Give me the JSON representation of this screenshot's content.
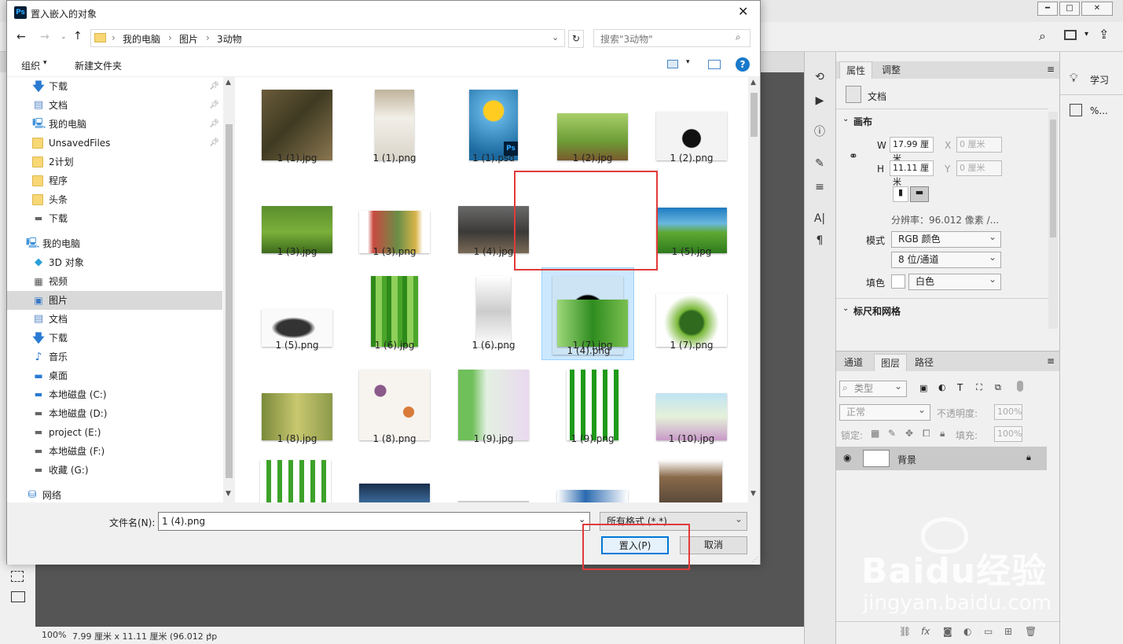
{
  "colors": {
    "accent": "#0078d7",
    "selection": "#cce8ff",
    "red_highlight": "#e23a3a",
    "ps_blue": "#001e36"
  },
  "dialog": {
    "title": "置入嵌入的对象",
    "breadcrumb": [
      "我的电脑",
      "图片",
      "3动物"
    ],
    "search_placeholder": "搜索\"3动物\"",
    "toolbar": {
      "organize": "组织",
      "new_folder": "新建文件夹"
    },
    "nav": [
      {
        "label": "下载",
        "icon": "download-icon",
        "pinned": true
      },
      {
        "label": "文档",
        "icon": "document-icon",
        "pinned": true
      },
      {
        "label": "我的电脑",
        "icon": "computer-icon",
        "pinned": true
      },
      {
        "label": "UnsavedFiles",
        "icon": "folder-icon",
        "pinned": true
      },
      {
        "label": "2计划",
        "icon": "folder-icon",
        "pinned": false
      },
      {
        "label": "程序",
        "icon": "folder-icon",
        "pinned": false
      },
      {
        "label": "头条",
        "icon": "folder-icon",
        "pinned": false
      },
      {
        "label": "下载",
        "icon": "drive-icon",
        "pinned": false
      },
      {
        "label": "我的电脑",
        "icon": "computer-icon",
        "pinned": false
      },
      {
        "label": "3D 对象",
        "icon": "cube-icon",
        "pinned": false
      },
      {
        "label": "视频",
        "icon": "video-icon",
        "pinned": false
      },
      {
        "label": "图片",
        "icon": "picture-icon",
        "pinned": false
      },
      {
        "label": "文档",
        "icon": "document-icon",
        "pinned": false
      },
      {
        "label": "下载",
        "icon": "download-icon",
        "pinned": false
      },
      {
        "label": "音乐",
        "icon": "music-icon",
        "pinned": false
      },
      {
        "label": "桌面",
        "icon": "desktop-icon",
        "pinned": false
      },
      {
        "label": "本地磁盘 (C:)",
        "icon": "windows-drive-icon",
        "pinned": false
      },
      {
        "label": "本地磁盘 (D:)",
        "icon": "drive-icon",
        "pinned": false
      },
      {
        "label": "project (E:)",
        "icon": "drive-icon",
        "pinned": false
      },
      {
        "label": "本地磁盘 (F:)",
        "icon": "drive-icon",
        "pinned": false
      },
      {
        "label": "收藏 (G:)",
        "icon": "drive-icon",
        "pinned": false
      },
      {
        "label": "网络",
        "icon": "network-icon",
        "pinned": false
      }
    ],
    "files": [
      {
        "name": "1 (1).jpg"
      },
      {
        "name": "1 (1).png"
      },
      {
        "name": "1 (1).psd"
      },
      {
        "name": "1 (2).jpg"
      },
      {
        "name": "1 (2).png"
      },
      {
        "name": "1 (3).jpg"
      },
      {
        "name": "1 (3).png"
      },
      {
        "name": "1 (4).jpg"
      },
      {
        "name": "1 (4).png"
      },
      {
        "name": "1 (5).jpg"
      },
      {
        "name": "1 (5).png"
      },
      {
        "name": "1 (6).jpg"
      },
      {
        "name": "1 (6).png"
      },
      {
        "name": "1 (7).jpg"
      },
      {
        "name": "1 (7).png"
      },
      {
        "name": "1 (8).jpg"
      },
      {
        "name": "1 (8).png"
      },
      {
        "name": "1 (9).jpg"
      },
      {
        "name": "1 (9).png"
      },
      {
        "name": "1 (10).jpg"
      }
    ],
    "selected_file": "1 (4).png",
    "filename_label": "文件名(N):",
    "filename_value": "1 (4).png",
    "filetype_value": "所有格式 (*.*)",
    "place_button": "置入(P)",
    "cancel_button": "取消"
  },
  "photoshop": {
    "status": {
      "zoom": "100%",
      "info": "7.99 厘米 x 11.11 厘米 (96.012 pp"
    },
    "properties": {
      "tabs": [
        "属性",
        "调整"
      ],
      "doc_label": "文档",
      "canvas_section": "画布",
      "w_label": "W",
      "w_value": "17.99 厘米",
      "h_label": "H",
      "h_value": "11.11 厘米",
      "x_label": "X",
      "x_value": "0 厘米",
      "y_label": "Y",
      "y_value": "0 厘米",
      "resolution": "分辨率：96.012 像素 /...",
      "mode_label": "模式",
      "mode_value": "RGB 颜色",
      "bit_value": "8 位/通道",
      "fill_label": "填色",
      "fill_value": "白色",
      "rulers_section": "标尺和网格"
    },
    "layers": {
      "tabs": [
        "通道",
        "图层",
        "路径"
      ],
      "filter": "类型",
      "blend": "正常",
      "opacity_label": "不透明度:",
      "opacity_value": "100%",
      "lock_label": "锁定:",
      "fill_label": "填充:",
      "fill_value": "100%",
      "layer_name": "背景"
    },
    "learn": {
      "label": "学习",
      "percent": "%..."
    }
  },
  "watermark": {
    "brand": "Baidu经验",
    "url": "jingyan.baidu.com"
  }
}
